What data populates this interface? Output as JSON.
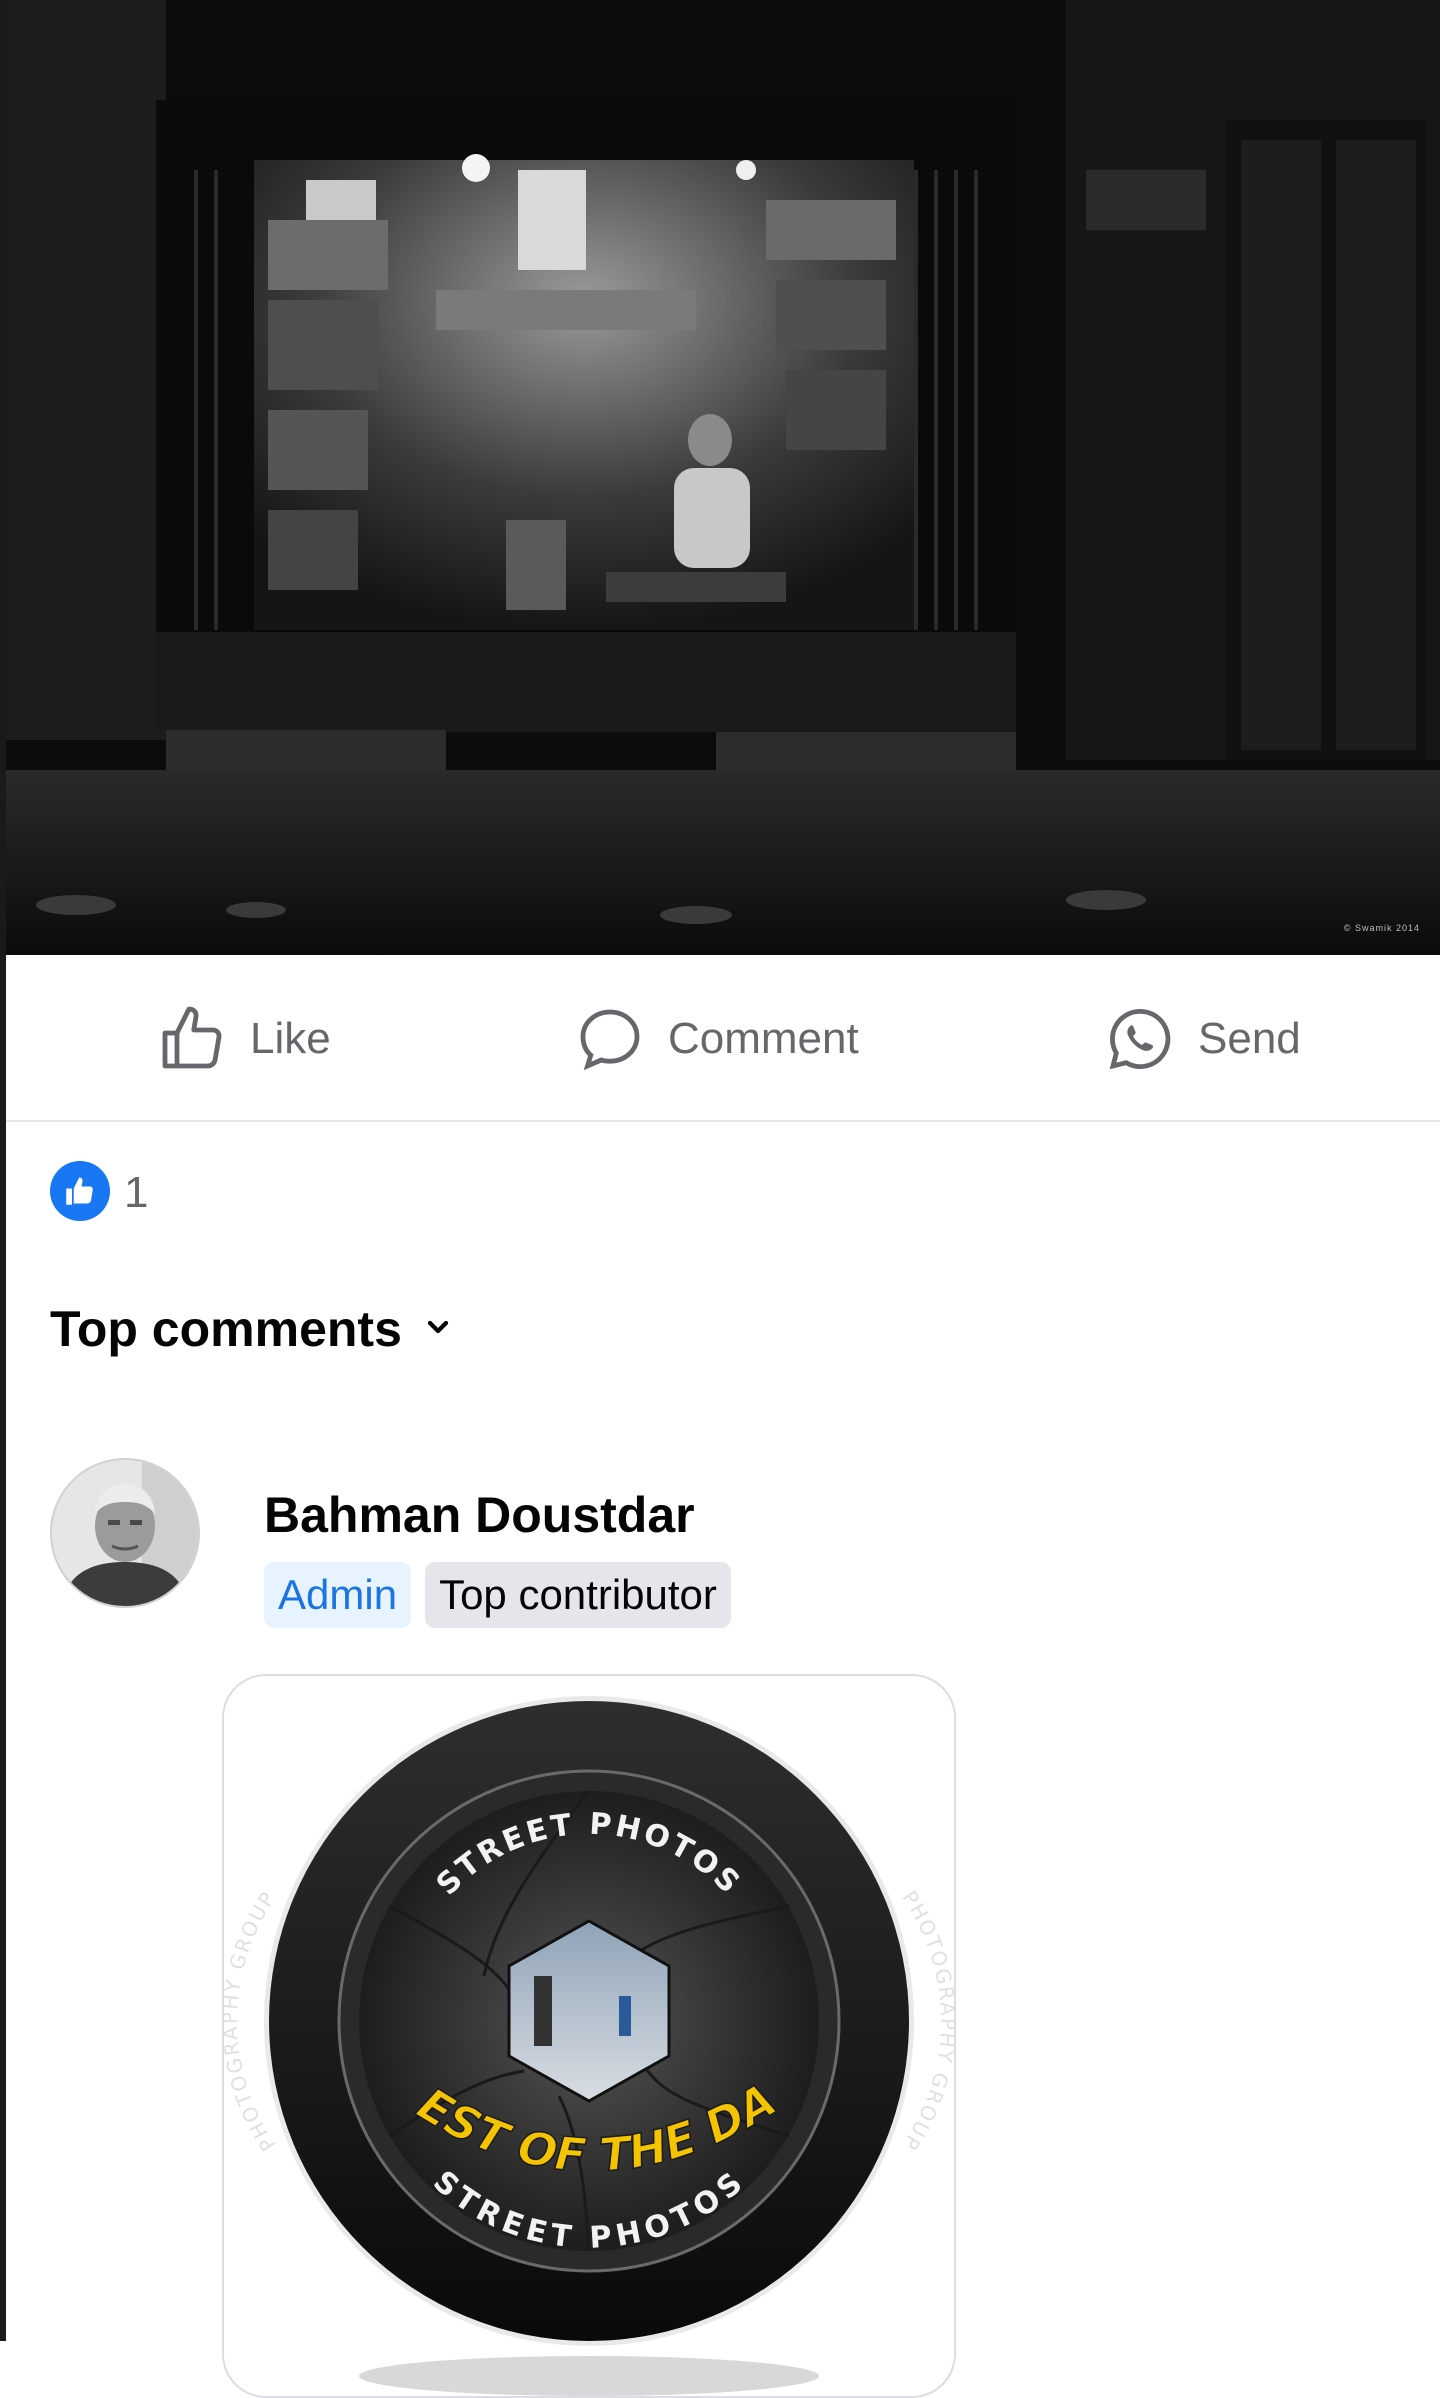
{
  "post": {
    "photo_watermark": "© Swamik 2014"
  },
  "actions": {
    "like_label": "Like",
    "comment_label": "Comment",
    "send_label": "Send"
  },
  "reactions": {
    "count": "1"
  },
  "comments": {
    "sort_label": "Top comments",
    "items": [
      {
        "author": "Bahman Doustdar",
        "badges": [
          "Admin",
          "Top contributor"
        ],
        "sticker": {
          "ring_text_top": "STREET PHOTOS",
          "ring_text_bottom": "STREET PHOTOS",
          "ring_text_left": "PHOTOGRAPHY GROUP",
          "ring_text_right": "PHOTOGRAPHY GROUP",
          "banner_text": "BEST OF THE DAY"
        }
      }
    ]
  },
  "colors": {
    "like_blue": "#1877f2",
    "action_gray": "#65676b",
    "admin_badge_bg": "#e7f3ff",
    "admin_badge_text": "#1b74e4",
    "badge_gray_bg": "#e4e6eb",
    "sticker_yellow": "#f5c400"
  },
  "icons": [
    "thumbs-up-outline-icon",
    "speech-bubble-icon",
    "whatsapp-icon",
    "like-reaction-icon",
    "chevron-down-icon"
  ]
}
